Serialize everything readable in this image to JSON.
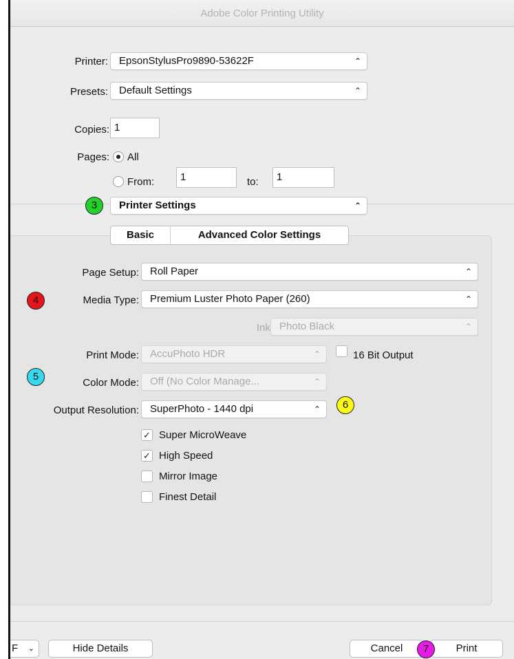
{
  "window": {
    "title": "Adobe Color Printing Utility"
  },
  "colors": {
    "badge_green": "#22d22a",
    "badge_red": "#e8141d",
    "badge_cyan": "#37d9f0",
    "badge_yellow": "#fafa14",
    "badge_magenta": "#e61be6"
  },
  "printer": {
    "label": "Printer:",
    "value": "EpsonStylusPro9890-53622F"
  },
  "presets": {
    "label": "Presets:",
    "value": "Default Settings"
  },
  "copies": {
    "label": "Copies:",
    "value": "1"
  },
  "pages": {
    "label": "Pages:",
    "all_label": "All",
    "from_label": "From:",
    "from_value": "1",
    "to_label": "to:",
    "to_value": "1",
    "selected": "All"
  },
  "section": {
    "badge": "3",
    "value": "Printer Settings"
  },
  "tabs": [
    {
      "label": "Basic"
    },
    {
      "label": "Advanced Color Settings"
    }
  ],
  "settings": {
    "page_setup": {
      "label": "Page Setup:",
      "value": "Roll Paper"
    },
    "media_type": {
      "badge": "4",
      "label": "Media Type:",
      "value": "Premium Luster Photo Paper (260)"
    },
    "ink": {
      "label": "Ink:",
      "value": "Photo Black"
    },
    "print_mode": {
      "label": "Print Mode:",
      "value": "AccuPhoto HDR"
    },
    "bit16": {
      "label": "16 Bit Output",
      "checked": false
    },
    "color_mode": {
      "badge": "5",
      "label": "Color Mode:",
      "value": "Off (No Color Manage..."
    },
    "output_resolution": {
      "label": "Output Resolution:",
      "value": "SuperPhoto - 1440 dpi",
      "badge": "6"
    },
    "options": [
      {
        "label": "Super MicroWeave",
        "checked": true,
        "mark": "✓"
      },
      {
        "label": "High Speed",
        "checked": true,
        "mark": "✓"
      },
      {
        "label": "Mirror Image",
        "checked": false,
        "mark": ""
      },
      {
        "label": "Finest Detail",
        "checked": false,
        "mark": ""
      }
    ]
  },
  "footer": {
    "pdf_label": "F",
    "hide_details": "Hide Details",
    "cancel": "Cancel",
    "print": "Print",
    "badge": "7"
  },
  "icons": {
    "popup_chevron": "up-down-chevron-icon",
    "pdf_chevron": "chevron-down-icon",
    "checkmark": "checkmark-icon"
  }
}
